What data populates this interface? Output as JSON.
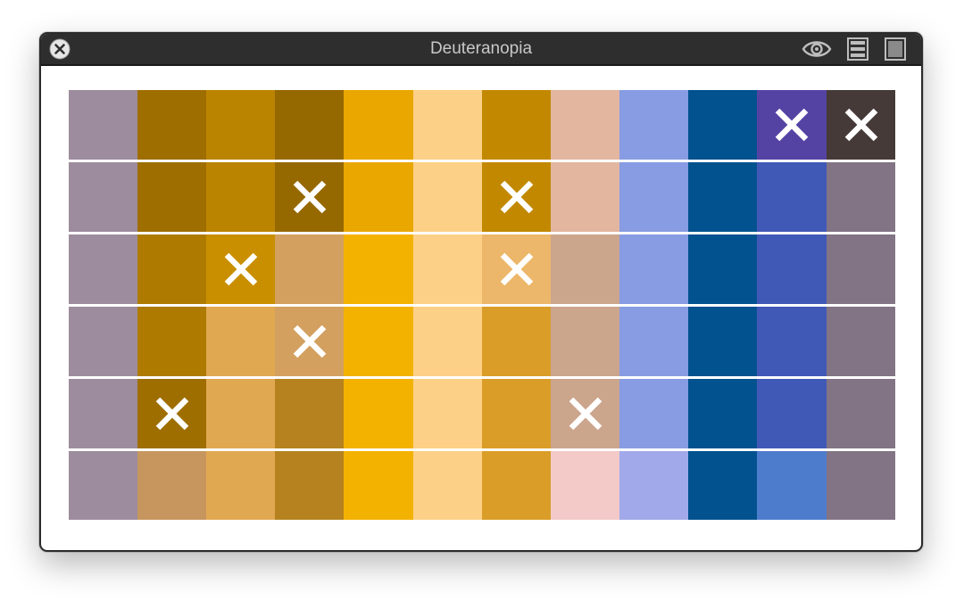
{
  "window": {
    "title": "Deuteranopia"
  },
  "toolbar": {
    "close_icon": "close-icon",
    "eye_icon": "eye-icon",
    "list_icon": "list-icon",
    "square_icon": "square-icon"
  },
  "swatch_grid": {
    "rows": [
      [
        {
          "color": "#9d8c9e",
          "marked": false
        },
        {
          "color": "#9e6e00",
          "marked": false
        },
        {
          "color": "#bb8400",
          "marked": false
        },
        {
          "color": "#966800",
          "marked": false
        },
        {
          "color": "#e9a700",
          "marked": false
        },
        {
          "color": "#fdd087",
          "marked": false
        },
        {
          "color": "#c28900",
          "marked": false
        },
        {
          "color": "#e3b6a0",
          "marked": false
        },
        {
          "color": "#879ce2",
          "marked": false
        },
        {
          "color": "#02528f",
          "marked": false
        },
        {
          "color": "#5543a4",
          "marked": true
        },
        {
          "color": "#453a38",
          "marked": true
        }
      ],
      [
        {
          "color": "#9d8c9e",
          "marked": false
        },
        {
          "color": "#9e6e00",
          "marked": false
        },
        {
          "color": "#bb8400",
          "marked": false
        },
        {
          "color": "#966800",
          "marked": true
        },
        {
          "color": "#e9a700",
          "marked": false
        },
        {
          "color": "#fdd087",
          "marked": false
        },
        {
          "color": "#c28900",
          "marked": true
        },
        {
          "color": "#e3b6a0",
          "marked": false
        },
        {
          "color": "#879ce2",
          "marked": false
        },
        {
          "color": "#02528f",
          "marked": false
        },
        {
          "color": "#4059b7",
          "marked": false
        },
        {
          "color": "#827484",
          "marked": false
        }
      ],
      [
        {
          "color": "#9d8c9e",
          "marked": false
        },
        {
          "color": "#ae7b00",
          "marked": false
        },
        {
          "color": "#c98f00",
          "marked": true
        },
        {
          "color": "#d3a060",
          "marked": false
        },
        {
          "color": "#f4b200",
          "marked": false
        },
        {
          "color": "#fdd087",
          "marked": false
        },
        {
          "color": "#ecb76a",
          "marked": true
        },
        {
          "color": "#cca58d",
          "marked": false
        },
        {
          "color": "#879ce2",
          "marked": false
        },
        {
          "color": "#02528f",
          "marked": false
        },
        {
          "color": "#4059b7",
          "marked": false
        },
        {
          "color": "#827484",
          "marked": false
        }
      ],
      [
        {
          "color": "#9d8c9e",
          "marked": false
        },
        {
          "color": "#ae7b00",
          "marked": false
        },
        {
          "color": "#e1a852",
          "marked": false
        },
        {
          "color": "#d3a060",
          "marked": true
        },
        {
          "color": "#f4b200",
          "marked": false
        },
        {
          "color": "#fdd087",
          "marked": false
        },
        {
          "color": "#da9d27",
          "marked": false
        },
        {
          "color": "#cca58d",
          "marked": false
        },
        {
          "color": "#879ce2",
          "marked": false
        },
        {
          "color": "#02528f",
          "marked": false
        },
        {
          "color": "#4059b7",
          "marked": false
        },
        {
          "color": "#827484",
          "marked": false
        }
      ],
      [
        {
          "color": "#9d8c9e",
          "marked": false
        },
        {
          "color": "#9e6e00",
          "marked": true
        },
        {
          "color": "#e1a852",
          "marked": false
        },
        {
          "color": "#b5821f",
          "marked": false
        },
        {
          "color": "#f4b200",
          "marked": false
        },
        {
          "color": "#fdd087",
          "marked": false
        },
        {
          "color": "#da9d27",
          "marked": false
        },
        {
          "color": "#cca58d",
          "marked": true
        },
        {
          "color": "#879ce2",
          "marked": false
        },
        {
          "color": "#02528f",
          "marked": false
        },
        {
          "color": "#4059b7",
          "marked": false
        },
        {
          "color": "#827484",
          "marked": false
        }
      ],
      [
        {
          "color": "#9d8c9e",
          "marked": false
        },
        {
          "color": "#c6965e",
          "marked": false
        },
        {
          "color": "#e1a852",
          "marked": false
        },
        {
          "color": "#b5821f",
          "marked": false
        },
        {
          "color": "#f4b200",
          "marked": false
        },
        {
          "color": "#fdd087",
          "marked": false
        },
        {
          "color": "#da9d27",
          "marked": false
        },
        {
          "color": "#f3cac8",
          "marked": false
        },
        {
          "color": "#a2a9ea",
          "marked": false
        },
        {
          "color": "#02528f",
          "marked": false
        },
        {
          "color": "#4e7ccc",
          "marked": false
        },
        {
          "color": "#827484",
          "marked": false
        }
      ]
    ],
    "marker_icon": "x-mark-icon",
    "marker_color": "#ffffff"
  }
}
